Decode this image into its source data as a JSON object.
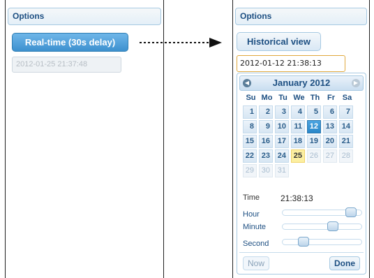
{
  "left": {
    "header": "Options",
    "realtime_button": "Real-time (30s delay)",
    "datetime_value": "2012-01-25 21:37:48"
  },
  "right": {
    "header": "Options",
    "historical_button": "Historical view",
    "datetime_value": "2012-01-12 21:38:13",
    "calendar": {
      "prev_icon": "chevron-left-icon",
      "next_icon": "chevron-right-icon",
      "month_year": "January 2012",
      "weekdays": [
        "Su",
        "Mo",
        "Tu",
        "We",
        "Th",
        "Fr",
        "Sa"
      ],
      "weeks": [
        [
          "1",
          "2",
          "3",
          "4",
          "5",
          "6",
          "7"
        ],
        [
          "8",
          "9",
          "10",
          "11",
          "12",
          "13",
          "14"
        ],
        [
          "15",
          "16",
          "17",
          "18",
          "19",
          "20",
          "21"
        ],
        [
          "22",
          "23",
          "24",
          "25",
          "26",
          "27",
          "28"
        ],
        [
          "29",
          "30",
          "31"
        ]
      ],
      "selected_day": "12",
      "today_day": "25",
      "disabled_days": [
        "26",
        "27",
        "28",
        "29",
        "30",
        "31"
      ]
    },
    "time": {
      "label": "Time",
      "value": "21:38:13",
      "hour_label": "Hour",
      "minute_label": "Minute",
      "second_label": "Second",
      "hour_value": 21,
      "minute_value": 38,
      "second_value": 13
    },
    "footer": {
      "now_label": "Now",
      "done_label": "Done"
    }
  },
  "colors": {
    "accent": "#3d91cf",
    "header_text": "#1d4f82",
    "today": "#fcefa1",
    "input_focus": "#e0a83d"
  }
}
